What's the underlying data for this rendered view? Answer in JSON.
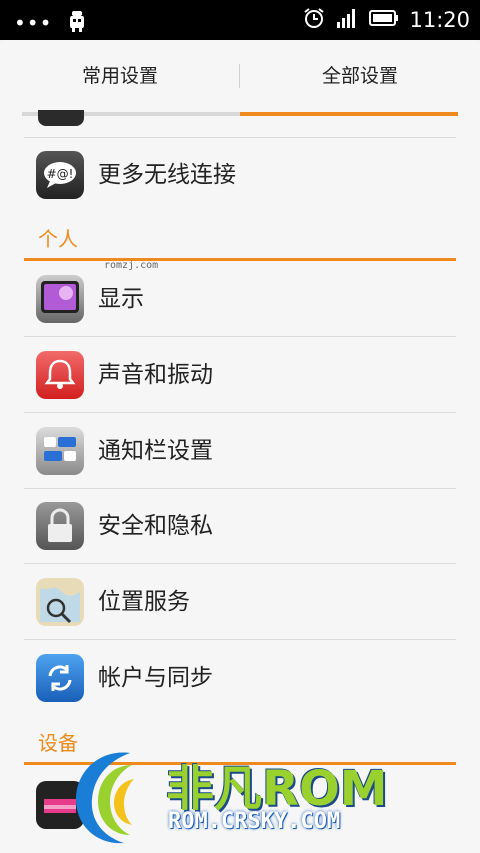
{
  "status_bar": {
    "time": "11:20",
    "icons": [
      "more-dots-icon",
      "android-debug-icon",
      "alarm-icon",
      "signal-icon",
      "battery-icon"
    ]
  },
  "tabs": [
    {
      "label": "常用设置",
      "active": false
    },
    {
      "label": "全部设置",
      "active": true
    }
  ],
  "rows_top": [
    {
      "label": "更多无线连接",
      "icon": "more-wireless-icon"
    }
  ],
  "sections": [
    {
      "title": "个人",
      "items": [
        {
          "label": "显示",
          "icon": "display-icon"
        },
        {
          "label": "声音和振动",
          "icon": "bell-icon"
        },
        {
          "label": "通知栏设置",
          "icon": "notification-bar-icon"
        },
        {
          "label": "安全和隐私",
          "icon": "lock-icon"
        },
        {
          "label": "位置服务",
          "icon": "location-map-icon"
        },
        {
          "label": "帐户与同步",
          "icon": "sync-icon"
        }
      ]
    },
    {
      "title": "设备",
      "items": [
        {
          "label": "",
          "icon": "equalizer-icon"
        }
      ]
    }
  ],
  "watermark": {
    "small": "romzj.com",
    "brand": "非凡ROM",
    "site": "ROM.CRSKY.COM"
  },
  "colors": {
    "accent": "#f08a1c",
    "statusbar": "#000000",
    "background": "#f6f6f6"
  }
}
